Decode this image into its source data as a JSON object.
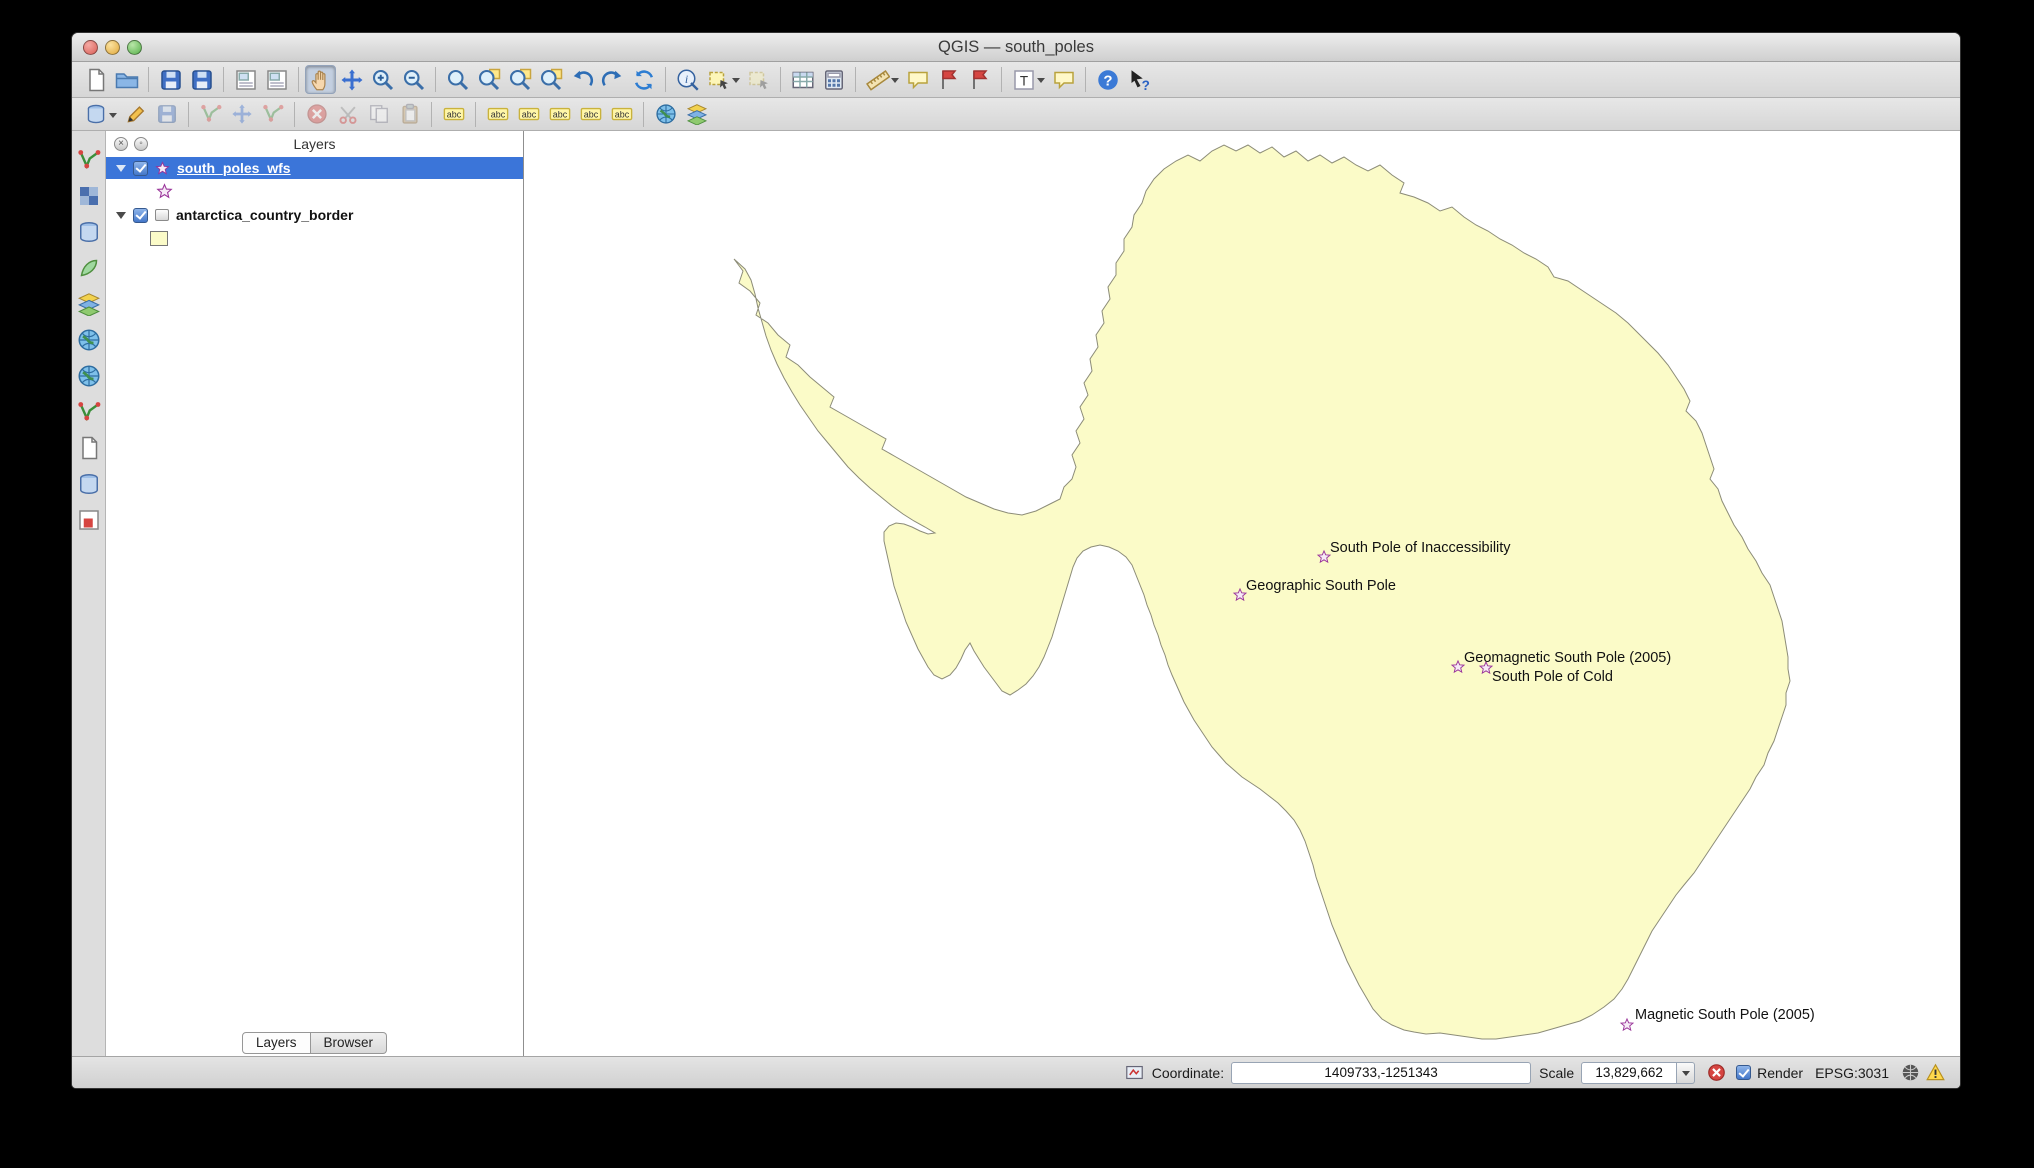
{
  "window": {
    "title": "QGIS — south_poles"
  },
  "toolbars": {
    "main": [
      "new-project",
      "open-project",
      "save-project",
      "save-project-as",
      "new-print-composer",
      "composer-manager",
      "pan-map",
      "pan-to-selection",
      "zoom-in",
      "zoom-out",
      "zoom-actual",
      "zoom-full",
      "zoom-to-selection",
      "zoom-to-layer",
      "zoom-last",
      "zoom-next",
      "refresh-map",
      "identify-features",
      "select-features",
      "deselect-features",
      "open-attribute-table",
      "field-calculator",
      "measure-line",
      "map-tips",
      "new-bookmark",
      "show-bookmarks",
      "text-annotation",
      "form-annotation",
      "help-contents",
      "whats-this"
    ],
    "digitizing": [
      "current-edits",
      "toggle-editing",
      "save-layer-edits",
      "add-feature",
      "move-feature",
      "node-tool",
      "delete-selected",
      "cut-features",
      "copy-features",
      "paste-features",
      "labeling",
      "move-label",
      "rotate-label",
      "pin-labels",
      "show-hide-labels",
      "change-label",
      "globe-plugin",
      "openlayers-plugin"
    ],
    "manage_layers": [
      "add-vector-layer",
      "add-raster-layer",
      "add-postgis-layer",
      "add-spatialite-layer",
      "add-mssql-layer",
      "add-wms-layer",
      "add-wcs-layer",
      "add-wfs-layer",
      "add-delimited-text-layer",
      "add-oracle-layer",
      "new-shapefile-layer"
    ]
  },
  "layers_panel": {
    "title": "Layers",
    "selection_color": "#3b75d9",
    "layers": [
      {
        "name": "south_poles_wfs",
        "checked": true,
        "selected": true,
        "symbol": "star"
      },
      {
        "name": "antarctica_country_border",
        "checked": true,
        "selected": false,
        "symbol": "polygon",
        "swatch_color": "#fbfbc8"
      }
    ],
    "tabs": [
      {
        "label": "Layers",
        "active": true
      },
      {
        "label": "Browser",
        "active": false
      }
    ]
  },
  "map": {
    "background": "#ffffff",
    "land_fill": "#fbfbc8",
    "land_outline": "#8c8c78",
    "marker": {
      "shape": "star",
      "stroke": "#993399",
      "fill": "#f6eaf6"
    },
    "labels": [
      {
        "text": "South Pole of Inaccessibility"
      },
      {
        "text": "Geographic South Pole"
      },
      {
        "text": "Geomagnetic South Pole (2005)"
      },
      {
        "text": "South Pole of Cold"
      },
      {
        "text": "Magnetic South Pole (2005)"
      }
    ]
  },
  "status_bar": {
    "coordinate_label": "Coordinate:",
    "coordinate_value": "1409733,-1251343",
    "scale_label": "Scale",
    "scale_value": "13,829,662",
    "render_label": "Render",
    "render_checked": true,
    "crs_label": "EPSG:3031"
  }
}
